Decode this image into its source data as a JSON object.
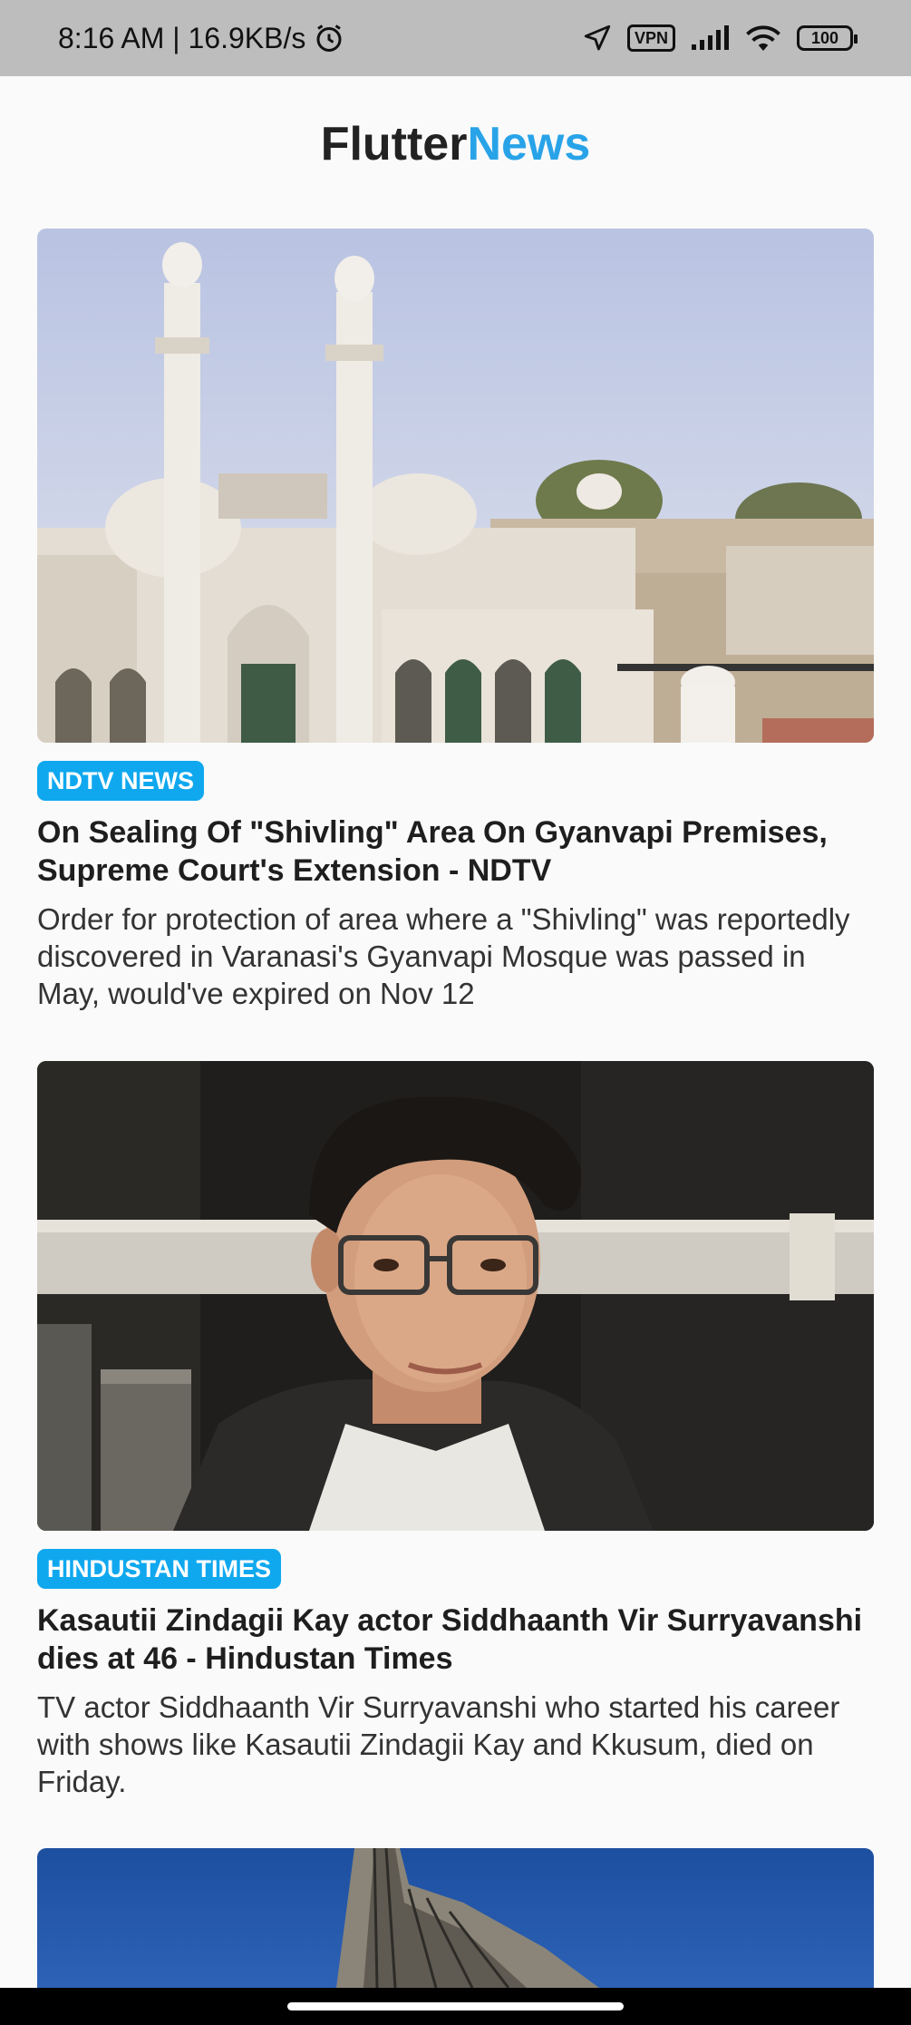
{
  "status_bar": {
    "time_speed": "8:16 AM | 16.9KB/s",
    "vpn": "VPN",
    "battery": "100"
  },
  "app_bar": {
    "title_part1": "Flutter",
    "title_part2": "News"
  },
  "articles": [
    {
      "source": "NDTV NEWS",
      "title": "On Sealing Of \"Shivling\" Area On Gyanvapi Premises, Supreme Court's Extension - NDTV",
      "description": "Order for protection of area where a \"Shivling\" was reportedly discovered in Varanasi's Gyanvapi Mosque was passed in May, would've expired on Nov 12"
    },
    {
      "source": "HINDUSTAN TIMES",
      "title": "Kasautii Zindagii Kay actor Siddhaanth Vir Surryavanshi dies at 46 - Hindustan Times",
      "description": "TV actor Siddhaanth Vir Surryavanshi who started his career with shows like Kasautii Zindagii Kay and Kkusum, died on Friday."
    }
  ],
  "colors": {
    "accent": "#29a3e8",
    "badge": "#0fa8ef",
    "status_bar": "#bdbdbd",
    "background": "#fafafa"
  }
}
